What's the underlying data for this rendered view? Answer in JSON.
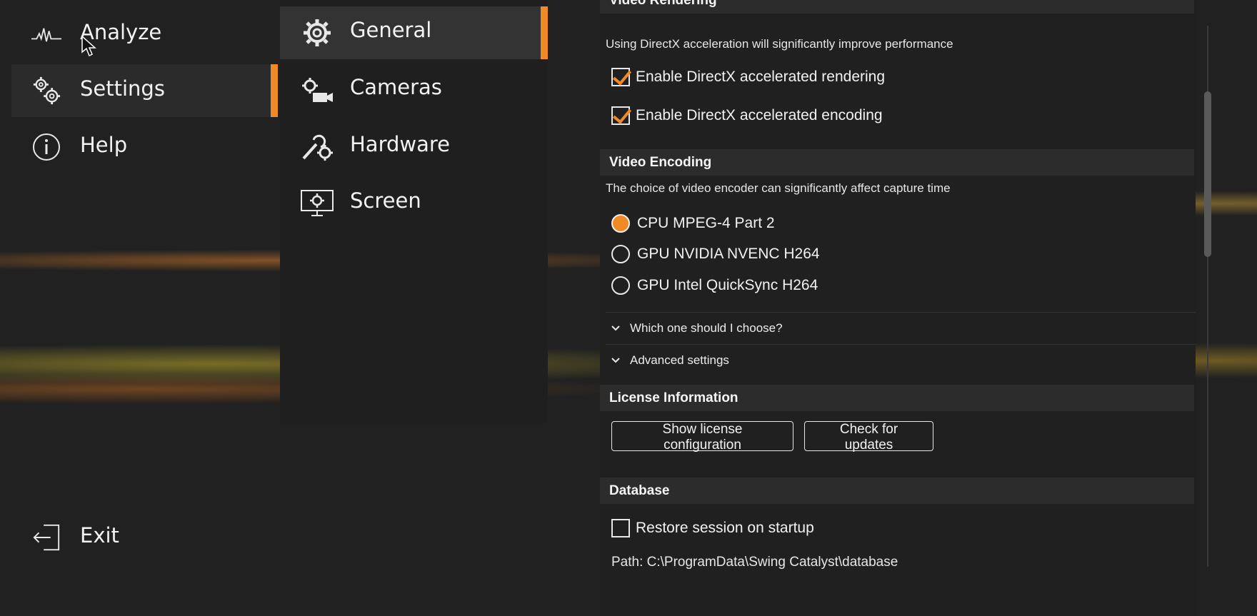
{
  "nav": {
    "items": [
      {
        "label": "Analyze",
        "icon": "analyze-waveform-icon"
      },
      {
        "label": "Settings",
        "icon": "gears-icon"
      },
      {
        "label": "Help",
        "icon": "info-icon"
      }
    ],
    "exit": {
      "label": "Exit",
      "icon": "exit-icon"
    }
  },
  "submenu": {
    "items": [
      {
        "label": "General",
        "icon": "gear-icon"
      },
      {
        "label": "Cameras",
        "icon": "camera-gear-icon"
      },
      {
        "label": "Hardware",
        "icon": "wrench-gear-icon"
      },
      {
        "label": "Screen",
        "icon": "monitor-gear-icon"
      }
    ]
  },
  "content": {
    "partial_heading": "Video Rendering",
    "rendering_desc": "Using DirectX acceleration will significantly improve performance",
    "directx_rendering": {
      "label": "Enable DirectX accelerated rendering",
      "checked": true
    },
    "directx_encoding": {
      "label": "Enable DirectX accelerated encoding",
      "checked": true
    },
    "video_encoding": {
      "title": "Video Encoding",
      "desc": "The choice of video encoder can significantly affect capture time",
      "options": [
        {
          "label": "CPU MPEG-4 Part 2",
          "selected": true
        },
        {
          "label": "GPU NVIDIA NVENC H264",
          "selected": false
        },
        {
          "label": "GPU Intel QuickSync H264",
          "selected": false
        }
      ],
      "which": "Which one should I choose?",
      "advanced": "Advanced settings"
    },
    "license": {
      "title": "License Information",
      "show_config": "Show license configuration",
      "check_updates": "Check for updates"
    },
    "database": {
      "title": "Database",
      "restore": {
        "label": "Restore session on startup",
        "checked": false
      },
      "path": "Path: C:\\ProgramData\\Swing Catalyst\\database"
    }
  },
  "colors": {
    "accent": "#f08a24",
    "background": "#212121",
    "section": "#2c2c2c"
  }
}
